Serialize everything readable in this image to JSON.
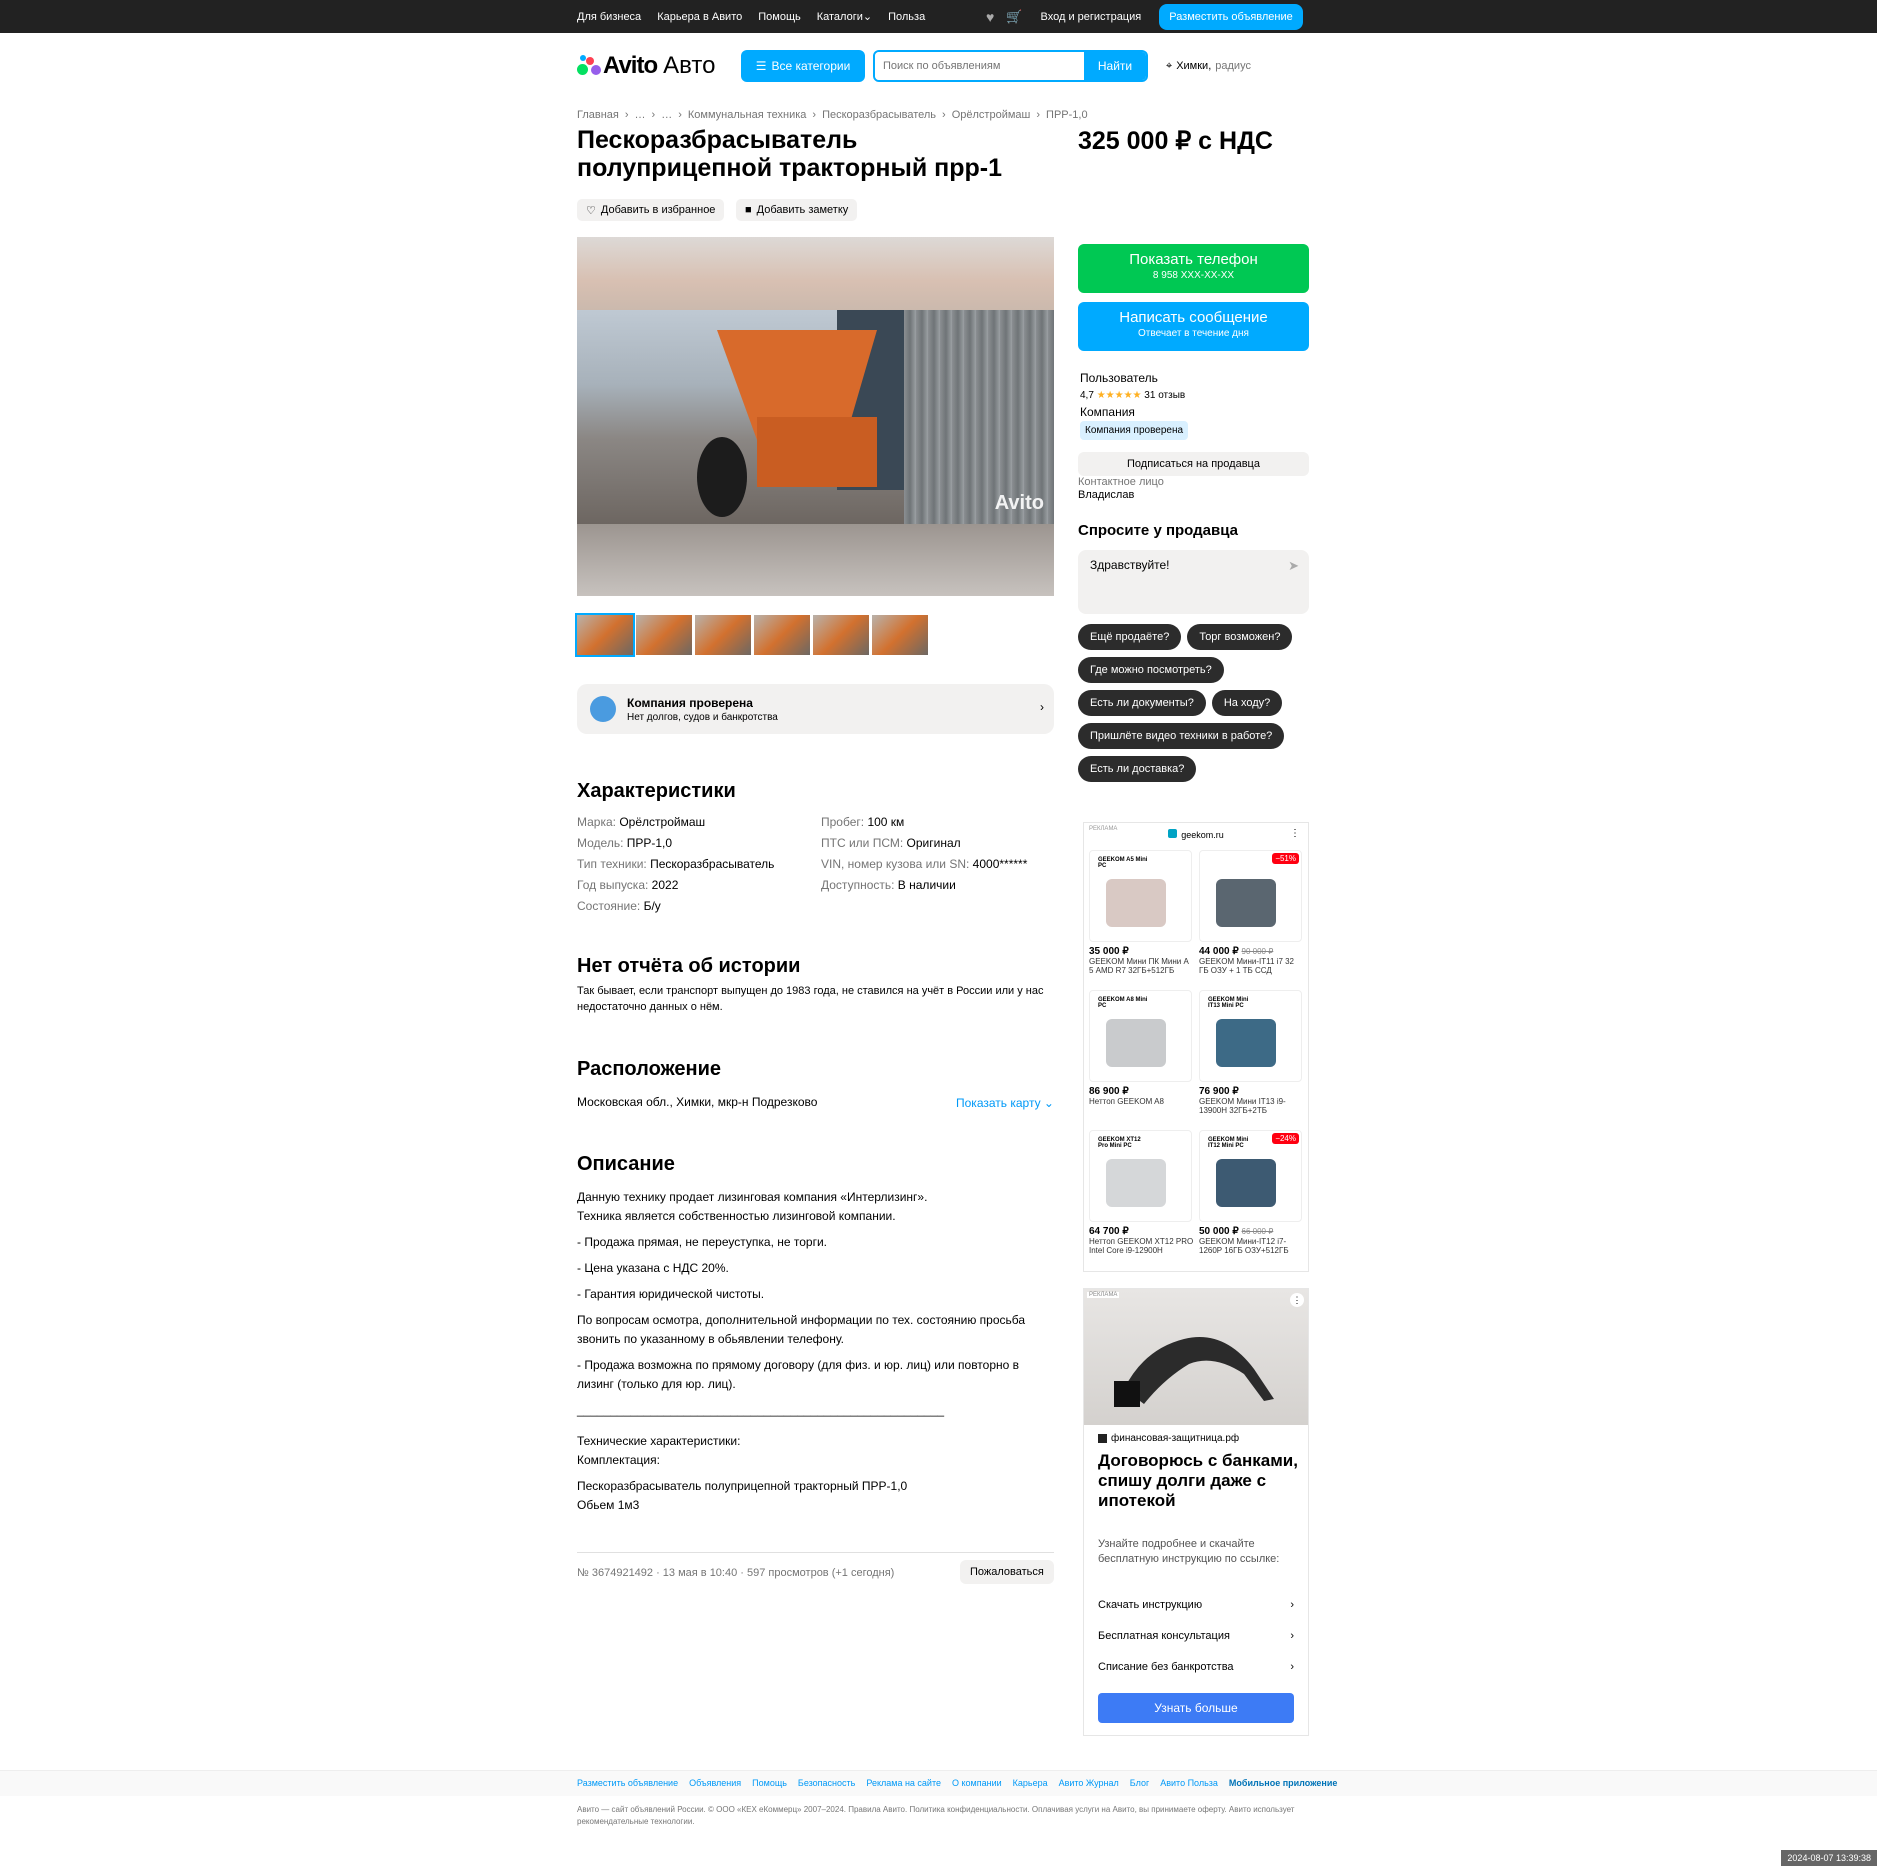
{
  "topbar": {
    "links": [
      "Для бизнеса",
      "Карьера в Авито",
      "Помощь",
      "Каталоги",
      "Польза"
    ],
    "login": "Вход и регистрация",
    "post_button": "Разместить объявление"
  },
  "header": {
    "logo_text": "Avito",
    "logo_sub": "Авто",
    "all_categories": "Все категории",
    "search_placeholder": "Поиск по объявлениям",
    "search_button": "Найти",
    "location": "Химки,",
    "location_radius": "радиус"
  },
  "breadcrumbs": [
    "Главная",
    "…",
    "…",
    "Коммунальная техника",
    "Пескоразбрасыватель",
    "Орёлстроймаш",
    "ПРР-1,0"
  ],
  "listing": {
    "title": "Пескоразбрасыватель полуприцепной тракторный прр-1",
    "price": "325 000 ₽ с НДС",
    "add_favorite": "Добавить в избранное",
    "add_note": "Добавить заметку",
    "photo_watermark": "Avito",
    "verified_title": "Компания проверена",
    "verified_sub": "Нет долгов, судов и банкротства"
  },
  "characteristics": {
    "heading": "Характеристики",
    "left": [
      {
        "k": "Марка:",
        "v": "Орёлстроймаш"
      },
      {
        "k": "Модель:",
        "v": "ПРР-1,0"
      },
      {
        "k": "Тип техники:",
        "v": "Пескоразбрасыватель"
      },
      {
        "k": "Год выпуска:",
        "v": "2022"
      },
      {
        "k": "Состояние:",
        "v": "Б/у"
      }
    ],
    "right": [
      {
        "k": "Пробег:",
        "v": "100 км"
      },
      {
        "k": "ПТС или ПСМ:",
        "v": "Оригинал"
      },
      {
        "k": "VIN, номер кузова или SN:",
        "v": "4000******"
      },
      {
        "k": "Доступность:",
        "v": "В наличии"
      }
    ]
  },
  "history": {
    "heading": "Нет отчёта об истории",
    "text": "Так бывает, если транспорт выпущен до 1983 года, не ставился на учёт в России или у нас недостаточно данных о нём."
  },
  "location": {
    "heading": "Расположение",
    "address": "Московская обл., Химки, мкр-н Подрезково",
    "show_map": "Показать карту"
  },
  "description": {
    "heading": "Описание",
    "p1": "Данную технику продает лизинговая компания «Интерлизинг».",
    "p1b": "Техника является собственностью лизинговой компании.",
    "p2": "- Продажа прямая, не переуступка, не торги.",
    "p3": "- Цена указана с НДС 20%.",
    "p4": "- Гарантия юридической чистоты.",
    "p5": "По вопросам осмотра, дополнительной информации по тех. состоянию просьба звонить по указанному в обьявлении телефону.",
    "p6": "- Продажа возможна по прямому договору (для физ. и юр. лиц) или повторно в лизинг (только для юр. лиц).",
    "line": "_______________________________________________________",
    "p7": "Технические характеристики:",
    "p7b": "Комплектация:",
    "p8": "Пескоразбрасыватель полуприцепной тракторный ПРР-1,0",
    "p8b": "Обьем 1м3"
  },
  "meta": {
    "text": "№ 3674921492 · 13 мая в 10:40 · 597 просмотров (+1 сегодня)",
    "complain": "Пожаловаться"
  },
  "sidebar": {
    "show_phone": "Показать телефон",
    "phone_masked": "8 958 XXX-XX-XX",
    "write": "Написать сообщение",
    "write_sub": "Отвечает в течение дня",
    "seller_name": "Пользователь",
    "rating": "4,7",
    "reviews": "31 отзыв",
    "seller_type": "Компания",
    "seller_badge": "Компания проверена",
    "subscribe": "Подписаться на продавца",
    "contact_label": "Контактное лицо",
    "contact_name": "Владислав",
    "ask_heading": "Спросите у продавца",
    "message": "Здравствуйте!",
    "questions": [
      "Ещё продаёте?",
      "Торг возможен?",
      "Где можно посмотреть?",
      "Есть ли документы?",
      "На ходу?",
      "Пришлёте видео техники в работе?",
      "Есть ли доставка?"
    ]
  },
  "ad1": {
    "label": "РЕКЛАМА",
    "domain": "geekom.ru",
    "products": [
      {
        "name": "GEEKOM A5 Mini PC",
        "price": "35 000 ₽",
        "old": "",
        "discount": "",
        "text": "GEEKOM Мини ПК Мини А 5 AMD R7 32ГБ+512ГБ",
        "color": "#d9c9c4"
      },
      {
        "name": "",
        "price": "44 000 ₽",
        "old": "90 000 ₽",
        "discount": "−51%",
        "text": "GEEKOM Мини-IT11 i7 32 ГБ ОЗУ + 1 ТБ ССД",
        "color": "#5a6670"
      },
      {
        "name": "GEEKOM A8 Mini PC",
        "price": "86 900 ₽",
        "old": "",
        "discount": "",
        "text": "Неттоп GEEKOM A8",
        "color": "#c9cbcd"
      },
      {
        "name": "GEEKOM Mini IT13 Mini PC",
        "price": "76 900 ₽",
        "old": "",
        "discount": "",
        "text": "GEEKOM Мини IT13 i9-13900H 32ГБ+2ТБ",
        "color": "#3d6a86"
      },
      {
        "name": "GEEKOM XT12 Pro Mini PC",
        "price": "64 700 ₽",
        "old": "",
        "discount": "",
        "text": "Неттоп GEEKOM XT12 PRO Intel Core i9-12900H",
        "color": "#d5d7d9"
      },
      {
        "name": "GEEKOM Mini IT12 Mini PC",
        "price": "50 000 ₽",
        "old": "66 000 ₽",
        "discount": "−24%",
        "text": "GEEKOM Мини-IT12 i7-1260P 16ГБ ОЗУ+512ГБ",
        "color": "#3d5a72"
      }
    ]
  },
  "ad2": {
    "label": "РЕКЛАМА",
    "domain": "финансовая-защитница.рф",
    "headline": "Договорюсь с банками, спишу долги даже с ипотекой",
    "body": "Узнайте подробнее и скачайте бесплатную инструкцию по ссылке:",
    "rows": [
      "Скачать инструкцию",
      "Бесплатная консультация",
      "Списание без банкротства"
    ],
    "cta": "Узнать больше"
  },
  "footer": {
    "links": [
      "Разместить объявление",
      "Объявления",
      "Помощь",
      "Безопасность",
      "Реклама на сайте",
      "О компании",
      "Карьера",
      "Авито Журнал",
      "Блог",
      "Авито Польза"
    ],
    "bold_link": "Мобильное приложение",
    "legal": "Авито — сайт объявлений России. © ООО «КЕХ еКоммерц» 2007–2024. Правила Авито. Политика конфиденциальности. Оплачивая услуги на Авито, вы принимаете оферту. Авито использует рекомендательные технологии."
  },
  "timestamp": "2024-08-07 13:39:38"
}
